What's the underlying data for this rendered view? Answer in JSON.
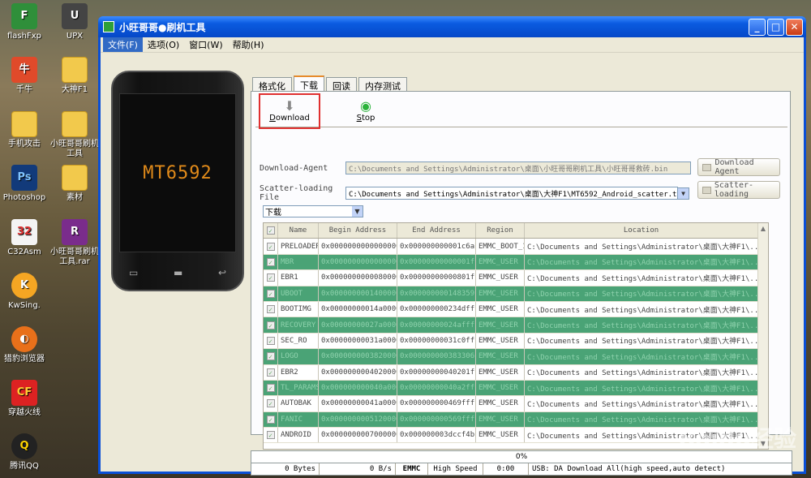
{
  "desktop": {
    "icons": [
      {
        "label": "flashFxp"
      },
      {
        "label": "UPX"
      },
      {
        "label": "千牛"
      },
      {
        "label": "大神F1"
      },
      {
        "label": "手机攻击"
      },
      {
        "label": "小旺哥哥刷机工具"
      },
      {
        "label": "Photoshop"
      },
      {
        "label": "素材"
      },
      {
        "label": "C32Asm"
      },
      {
        "label": "小旺哥哥刷机工具.rar"
      },
      {
        "label": "KwSing."
      },
      {
        "label": "猎豹浏览器"
      },
      {
        "label": "穿越火线"
      },
      {
        "label": "腾讯QQ"
      }
    ]
  },
  "window": {
    "title": "小旺哥哥●刷机工具",
    "menu": [
      "文件(F)",
      "选项(O)",
      "窗口(W)",
      "帮助(H)"
    ],
    "phone_label": "MT6592",
    "tabs": [
      "格式化",
      "下载",
      "回读",
      "内存测试"
    ],
    "toolbar": {
      "download": "Download",
      "stop": "Stop"
    },
    "download_agent_label": "Download-Agent",
    "download_agent_path": "C:\\Documents and Settings\\Administrator\\桌面\\小旺哥哥刷机工具\\小旺哥哥救砖.bin",
    "download_agent_button": "Download Agent",
    "scatter_label": "Scatter-loading File",
    "scatter_path": "C:\\Documents and Settings\\Administrator\\桌面\\大神F1\\MT6592_Android_scatter.txt",
    "scatter_button": "Scatter-loading",
    "mode_select": "下载",
    "grid_headers": [
      "Name",
      "Begin Address",
      "End Address",
      "Region",
      "Location"
    ],
    "grid_rows": [
      {
        "name": "PRELOADER",
        "begin": "0x0000000000000000",
        "end": "0x000000000001c6ab",
        "region": "EMMC_BOOT_1",
        "loc": "C:\\Documents and Settings\\Administrator\\桌面\\大神F1\\..."
      },
      {
        "name": "MBR",
        "begin": "0x0000000000000000",
        "end": "0x00000000000001ff",
        "region": "EMMC_USER",
        "loc": "C:\\Documents and Settings\\Administrator\\桌面\\大神F1\\..."
      },
      {
        "name": "EBR1",
        "begin": "0x0000000000080000",
        "end": "0x00000000000801ff",
        "region": "EMMC_USER",
        "loc": "C:\\Documents and Settings\\Administrator\\桌面\\大神F1\\..."
      },
      {
        "name": "UBOOT",
        "begin": "0x0000000001400000",
        "end": "0x000000000148359f",
        "region": "EMMC_USER",
        "loc": "C:\\Documents and Settings\\Administrator\\桌面\\大神F1\\..."
      },
      {
        "name": "BOOTIMG",
        "begin": "0x00000000014a0000",
        "end": "0x000000000234dfff",
        "region": "EMMC_USER",
        "loc": "C:\\Documents and Settings\\Administrator\\桌面\\大神F1\\..."
      },
      {
        "name": "RECOVERY",
        "begin": "0x00000000027a0000",
        "end": "0x00000000024affff",
        "region": "EMMC_USER",
        "loc": "C:\\Documents and Settings\\Administrator\\桌面\\大神F1\\..."
      },
      {
        "name": "SEC_RO",
        "begin": "0x00000000031a0000",
        "end": "0x00000000031c0fff",
        "region": "EMMC_USER",
        "loc": "C:\\Documents and Settings\\Administrator\\桌面\\大神F1\\..."
      },
      {
        "name": "LOGO",
        "begin": "0x0000000003820000",
        "end": "0x000000000383306b",
        "region": "EMMC_USER",
        "loc": "C:\\Documents and Settings\\Administrator\\桌面\\大神F1\\..."
      },
      {
        "name": "EBR2",
        "begin": "0x0000000004020000",
        "end": "0x00000000040201ff",
        "region": "EMMC_USER",
        "loc": "C:\\Documents and Settings\\Administrator\\桌面\\大神F1\\..."
      },
      {
        "name": "TL_PARAMS",
        "begin": "0x000000000040a0000",
        "end": "0x00000000040a2fff",
        "region": "EMMC_USER",
        "loc": "C:\\Documents and Settings\\Administrator\\桌面\\大神F1\\..."
      },
      {
        "name": "AUTOBAK",
        "begin": "0x00000000041a0000",
        "end": "0x000000000469ffff",
        "region": "EMMC_USER",
        "loc": "C:\\Documents and Settings\\Administrator\\桌面\\大神F1\\..."
      },
      {
        "name": "FANIC",
        "begin": "0x0000000005120000",
        "end": "0x000000000569ffff",
        "region": "EMMC_USER",
        "loc": "C:\\Documents and Settings\\Administrator\\桌面\\大神F1\\..."
      },
      {
        "name": "ANDROID",
        "begin": "0x0000000007000000",
        "end": "0x000000003dccf4bf",
        "region": "EMMC_USER",
        "loc": "C:\\Documents and Settings\\Administrator\\桌面\\大神F1\\..."
      }
    ],
    "progress_text": "0%",
    "status": {
      "bytes": "0 Bytes",
      "rate": "0 B/s",
      "storage": "EMMC",
      "speed": "High Speed",
      "time": "0:00",
      "info": "USB: DA Download All(high speed,auto detect)"
    }
  },
  "watermark": "Baidu经验"
}
